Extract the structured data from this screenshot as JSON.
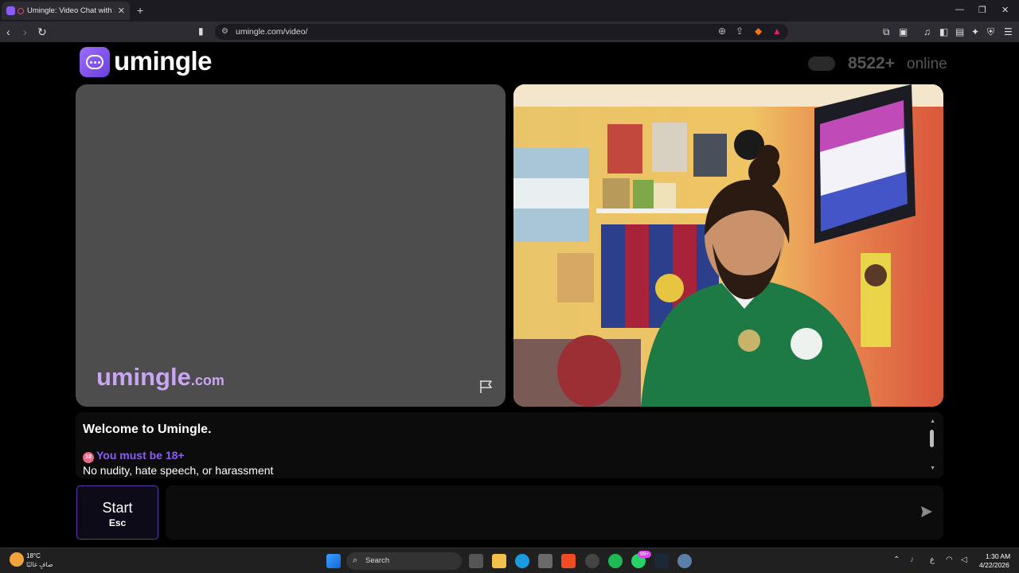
{
  "browser": {
    "tab_title": "Umingle: Video Chat with Str",
    "new_tab": "+",
    "url": "umingle.com/video/"
  },
  "site": {
    "logo_text": "umingle",
    "online_count": "8522+",
    "online_label": "online"
  },
  "video": {
    "watermark_main": "umingle",
    "watermark_tld": ".com"
  },
  "chat": {
    "title": "Welcome to Umingle.",
    "age_badge": "18",
    "age_warning": "You must be 18+",
    "rules": "No nudity, hate speech, or harassment"
  },
  "controls": {
    "start_label": "Start",
    "start_key": "Esc",
    "message_placeholder": ""
  },
  "taskbar": {
    "weather_temp": "18°C",
    "weather_desc": "صافٍ غالبًا",
    "search_label": "Search",
    "whatsapp_badge": "99+",
    "language": "ع",
    "time": "1:30 AM",
    "date": "4/22/2026"
  }
}
